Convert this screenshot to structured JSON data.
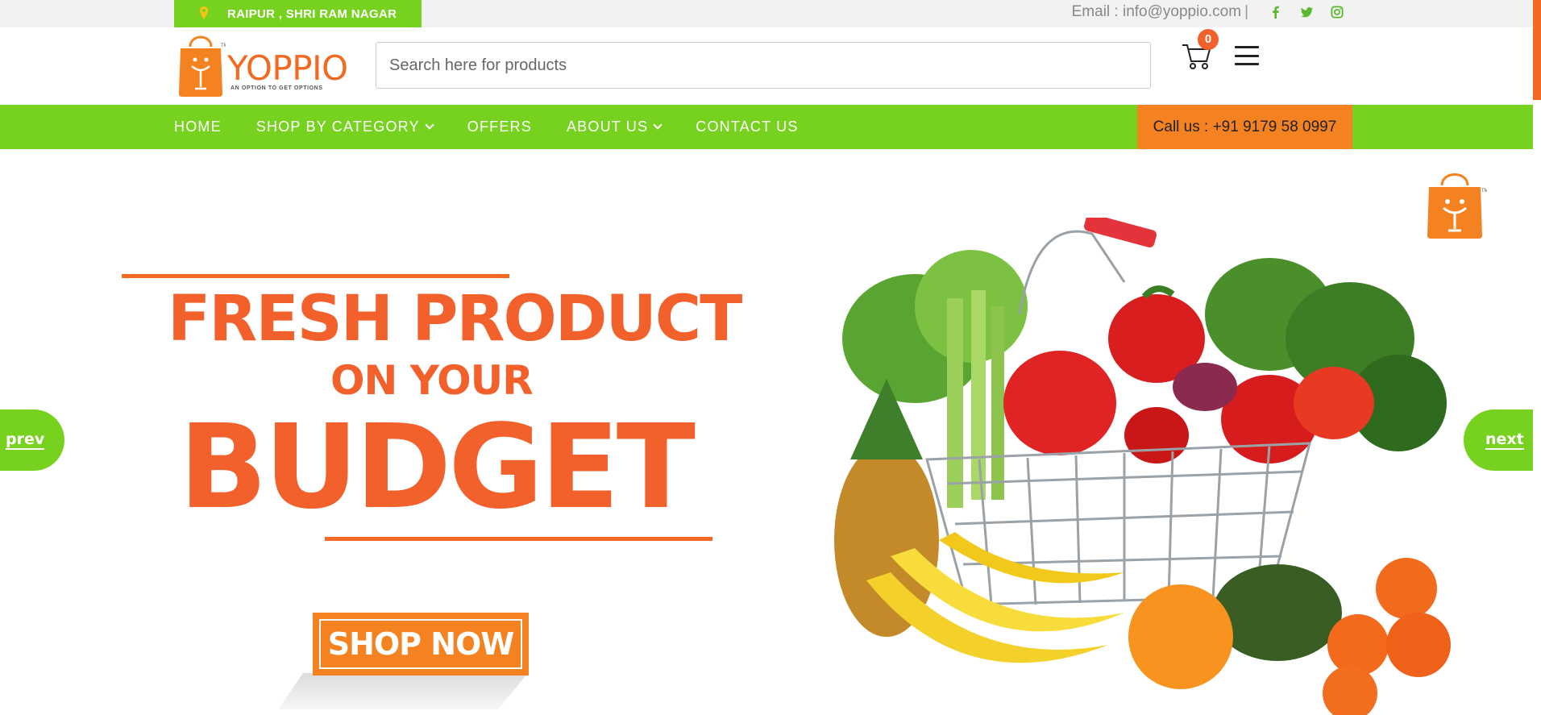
{
  "topbar": {
    "location": "RAIPUR , SHRI RAM NAGAR",
    "email": "Email : info@yoppio.com",
    "separator": "|",
    "social_icons": [
      "facebook-icon",
      "twitter-icon",
      "instagram-icon"
    ]
  },
  "header": {
    "logo_text": "YOPPIO",
    "logo_tagline": "AN OPTION TO GET OPTIONS",
    "search_placeholder": "Search here for products",
    "cart_count": "0"
  },
  "nav": {
    "items": [
      {
        "label": "HOME",
        "dropdown": false
      },
      {
        "label": "SHOP BY CATEGORY",
        "dropdown": true
      },
      {
        "label": "OFFERS",
        "dropdown": false
      },
      {
        "label": "ABOUT US",
        "dropdown": true
      },
      {
        "label": "CONTACT US",
        "dropdown": false
      }
    ],
    "call": "Call us : +91 9179 58 0997"
  },
  "hero": {
    "line1": "FRESH PRODUCT",
    "line2": "ON YOUR",
    "line3": "BUDGET",
    "cta": "SHOP NOW",
    "prev": "prev",
    "next": "next"
  },
  "colors": {
    "brand_green": "#76d21f",
    "brand_orange": "#f26a21",
    "cta_orange": "#f58220"
  }
}
